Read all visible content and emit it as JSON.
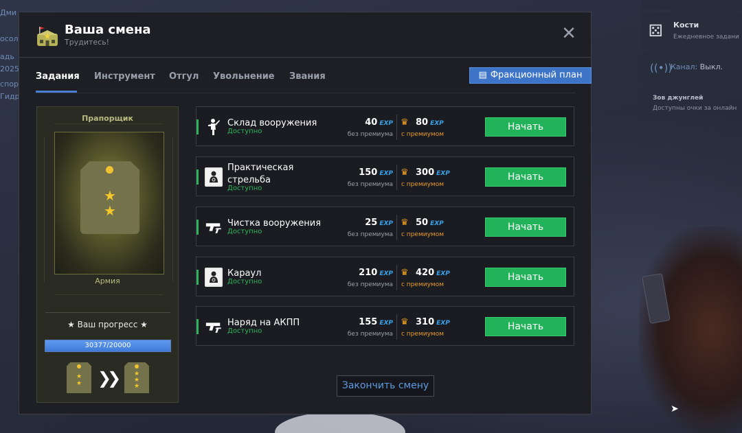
{
  "background": {
    "left_text": [
      "Дми",
      "осол",
      "адь",
      "2025",
      "спор",
      "Гидр"
    ],
    "right_panel": {
      "dice": {
        "title": "Кости",
        "subtitle": "Ежедневное задани"
      },
      "channel": {
        "label": "Канал:",
        "value": "Выкл."
      },
      "jungle": {
        "title": "Зов джунглей",
        "subtitle": "Доступны очки за онлайн"
      }
    }
  },
  "modal": {
    "title": "Ваша смена",
    "subtitle": "Трудитесь!",
    "close_icon": "close-icon"
  },
  "tabs": [
    {
      "label": "Задания",
      "active": true
    },
    {
      "label": "Инструмент",
      "active": false
    },
    {
      "label": "Отгул",
      "active": false
    },
    {
      "label": "Увольнение",
      "active": false
    },
    {
      "label": "Звания",
      "active": false
    }
  ],
  "plan_button": {
    "label": "Фракционный план",
    "icon": "document-icon"
  },
  "rank": {
    "name": "Прапорщик",
    "branch": "Армия",
    "progress_label": "★ Ваш прогресс ★",
    "progress_text": "30377/20000",
    "progress_fraction": 1.0,
    "current_stars": 2,
    "next_stars": 3
  },
  "exp_tag": "EXP",
  "base_note": "без премиума",
  "premium_note": "с премиумом",
  "tasks": [
    {
      "name": "Склад вооружения",
      "status": "Доступно",
      "base": "40",
      "premium": "80",
      "button": "Начать",
      "icon": "soldier-icon"
    },
    {
      "name": "Практическая стрельба",
      "status": "Доступно",
      "base": "150",
      "premium": "300",
      "button": "Начать",
      "icon": "target-icon"
    },
    {
      "name": "Чистка вооружения",
      "status": "Доступно",
      "base": "25",
      "premium": "50",
      "button": "Начать",
      "icon": "pistol-icon"
    },
    {
      "name": "Караул",
      "status": "Доступно",
      "base": "210",
      "premium": "420",
      "button": "Начать",
      "icon": "target-icon"
    },
    {
      "name": "Наряд на АКПП",
      "status": "Доступно",
      "base": "155",
      "premium": "310",
      "button": "Начать",
      "icon": "pistol-icon"
    }
  ],
  "finish_button": "Закончить смену",
  "colors": {
    "accent_blue": "#3e74c8",
    "start_green": "#22b35a",
    "available_green": "#2fb35b",
    "exp_blue": "#3aa0e8",
    "premium_orange": "#e89a2a"
  }
}
